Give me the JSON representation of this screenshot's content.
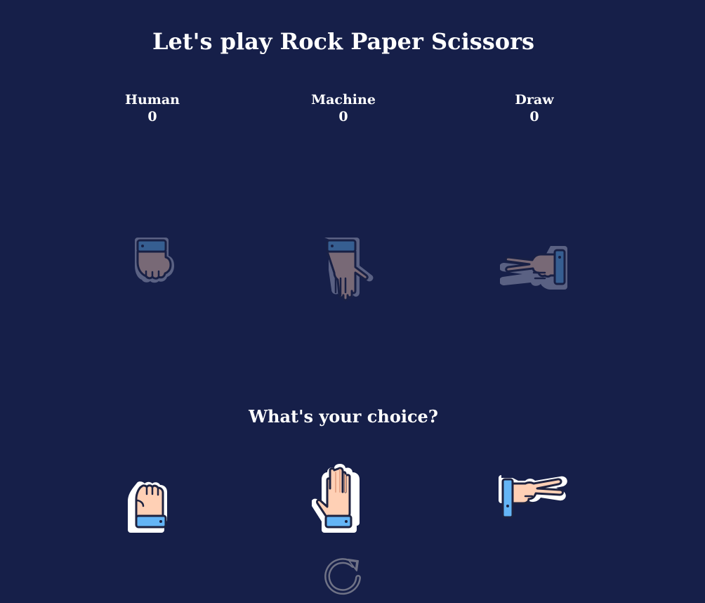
{
  "title": "Let's play Rock Paper Scissors",
  "scores": [
    {
      "label": "Human",
      "value": "0"
    },
    {
      "label": "Machine",
      "value": "0"
    },
    {
      "label": "Draw",
      "value": "0"
    }
  ],
  "display_hands": [
    "rock-hand-icon",
    "paper-hand-icon",
    "scissors-hand-icon"
  ],
  "prompt": "What's your choice?",
  "choices": [
    "rock",
    "paper",
    "scissors"
  ],
  "reset_icon": "refresh-icon",
  "colors": {
    "background": "#161f49",
    "skin": "#ffd0b5",
    "cuff": "#64b5f6",
    "outline": "#1d2240",
    "muted": "#8a8ea8"
  }
}
